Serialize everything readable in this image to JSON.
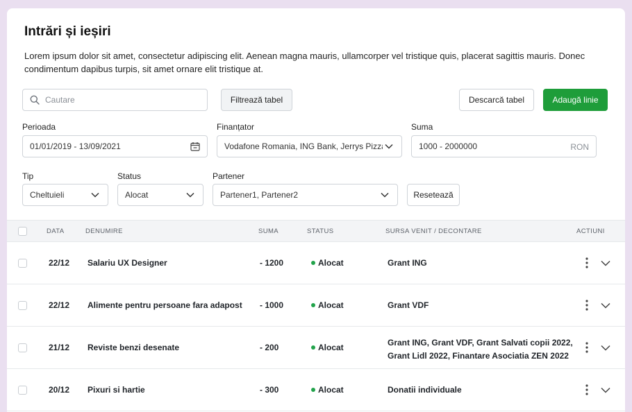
{
  "page": {
    "title": "Intrări și ieșiri",
    "description": "Lorem ipsum dolor sit amet, consectetur adipiscing elit. Aenean magna mauris, ullamcorper vel tristique quis, placerat sagittis mauris. Donec condimentum dapibus turpis, sit amet ornare elit tristique at."
  },
  "toolbar": {
    "search_placeholder": "Cautare",
    "filter_label": "Filtrează tabel",
    "download_label": "Descarcă tabel",
    "add_label": "Adaugă linie"
  },
  "filters": {
    "period": {
      "label": "Perioada",
      "value": "01/01/2019 - 13/09/2021"
    },
    "funder": {
      "label": "Finanțator",
      "value": "Vodafone Romania, ING Bank, Jerrys Pizza..."
    },
    "amount": {
      "label": "Suma",
      "value": "1000 - 2000000",
      "unit": "RON"
    },
    "type": {
      "label": "Tip",
      "value": "Cheltuieli"
    },
    "status": {
      "label": "Status",
      "value": "Alocat"
    },
    "partner": {
      "label": "Partener",
      "value": "Partener1, Partener2"
    },
    "reset_label": "Resetează"
  },
  "table": {
    "headers": {
      "date": "DATA",
      "name": "DENUMIRE",
      "amount": "SUMA",
      "status": "STATUS",
      "source": "SURSA VENIT / DECONTARE",
      "actions": "ACTIUNI"
    },
    "rows": [
      {
        "date": "22/12",
        "name": "Salariu UX Designer",
        "amount": "- 1200",
        "status": "Alocat",
        "source": [
          "Grant ING"
        ]
      },
      {
        "date": "22/12",
        "name": "Alimente pentru persoane fara adapost",
        "amount": "- 1000",
        "status": "Alocat",
        "source": [
          "Grant VDF"
        ]
      },
      {
        "date": "21/12",
        "name": "Reviste benzi desenate",
        "amount": "- 200",
        "status": "Alocat",
        "source": [
          "Grant ING, Grant VDF, Grant Salvati copii 2022,",
          "Grant Lidl 2022, Finantare Asociatia ZEN 2022"
        ]
      },
      {
        "date": "20/12",
        "name": "Pixuri si hartie",
        "amount": "- 300",
        "status": "Alocat",
        "source": [
          "Donatii individuale"
        ]
      }
    ]
  },
  "colors": {
    "accent": "#1e9d3a",
    "status_dot": "#22a34b",
    "background": "#eadff0"
  }
}
